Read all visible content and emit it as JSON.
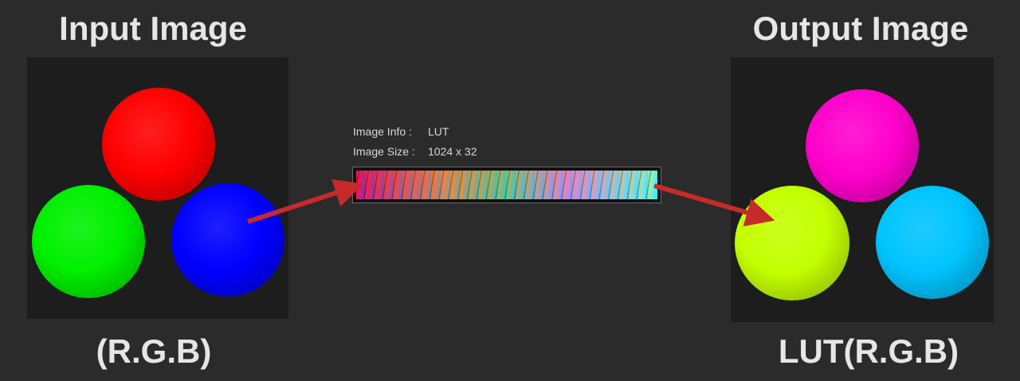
{
  "input": {
    "title": "Input Image",
    "caption": "(R.G.B)",
    "spheres": [
      {
        "name": "red",
        "color": "#ff0000"
      },
      {
        "name": "green",
        "color": "#00f000"
      },
      {
        "name": "blue",
        "color": "#0000ff"
      }
    ]
  },
  "output": {
    "title": "Output Image",
    "caption": "LUT(R.G.B)",
    "spheres": [
      {
        "name": "magenta",
        "color": "#ff00cc"
      },
      {
        "name": "yellow-green",
        "color": "#c4ff00"
      },
      {
        "name": "cyan",
        "color": "#00c4ff"
      }
    ]
  },
  "lut": {
    "info_label": "Image Info :",
    "info_value": "LUT",
    "size_label": "Image Size :",
    "size_value": "1024 x 32"
  },
  "colors": {
    "background": "#2b2b2b",
    "panel": "#1d1d1d",
    "arrow": "#c62a2a",
    "heading": "#e6e6e6"
  }
}
